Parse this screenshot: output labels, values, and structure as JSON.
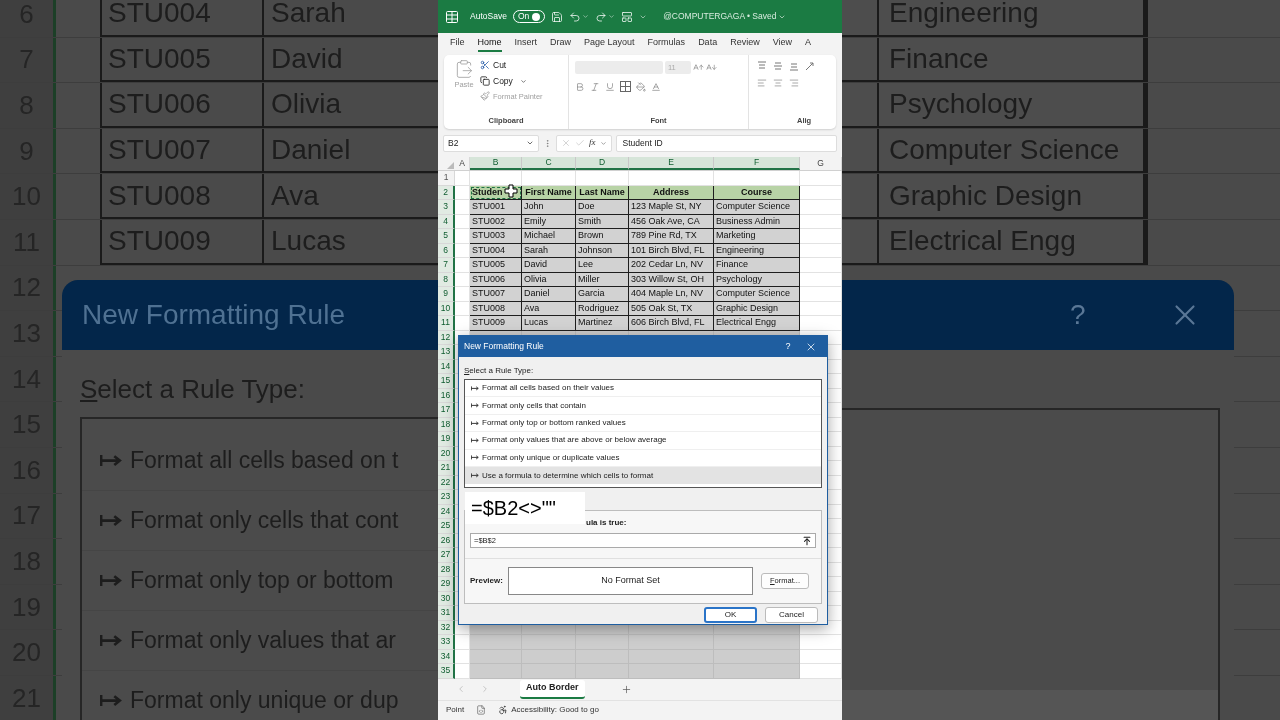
{
  "backdrop_left": {
    "row_numbers": [
      "6",
      "7",
      "8",
      "9",
      "10",
      "11",
      "12",
      "13",
      "14",
      "15",
      "16",
      "17",
      "18",
      "19",
      "20",
      "21"
    ],
    "rows": [
      [
        "STU004",
        "Sarah"
      ],
      [
        "STU005",
        "David"
      ],
      [
        "STU006",
        "Olivia"
      ],
      [
        "STU007",
        "Daniel"
      ],
      [
        "STU008",
        "Ava"
      ],
      [
        "STU009",
        "Lucas"
      ]
    ],
    "dialog": {
      "title": "New Formatting Rule",
      "label": "Select a Rule Type:",
      "rule_types": [
        "Format all cells based on t",
        "Format only cells that cont",
        "Format only top or bottom",
        "Format only values that ar",
        "Format only unique or dup"
      ]
    }
  },
  "excel": {
    "title_bar": {
      "autosave": "AutoSave",
      "toggle_label": "On",
      "autosave_on": true,
      "document": "@COMPUTERGAGA • Saved"
    },
    "tabs": [
      {
        "label": "File",
        "selected": false
      },
      {
        "label": "Home",
        "selected": true
      },
      {
        "label": "Insert",
        "selected": false
      },
      {
        "label": "Draw",
        "selected": false
      },
      {
        "label": "Page Layout",
        "selected": false
      },
      {
        "label": "Formulas",
        "selected": false
      },
      {
        "label": "Data",
        "selected": false
      },
      {
        "label": "Review",
        "selected": false
      },
      {
        "label": "View",
        "selected": false
      },
      {
        "label": "A",
        "selected": false
      }
    ],
    "ribbon": {
      "paste": {
        "label": "Paste",
        "disabled": true
      },
      "cut": {
        "label": "Cut",
        "disabled": false
      },
      "copy": {
        "label": "Copy",
        "disabled": false
      },
      "format_painter": {
        "label": "Format Painter",
        "disabled": true
      },
      "clipboard_label": "Clipboard",
      "font_size": "11",
      "font_label": "Font",
      "alignment_label": "Alig"
    },
    "formula_bar": {
      "name_box": "B2",
      "function_label": "fx",
      "value": "Student ID"
    },
    "sheet": {
      "columns": [
        {
          "label": "A",
          "selected": false
        },
        {
          "label": "B",
          "selected": true
        },
        {
          "label": "C",
          "selected": true
        },
        {
          "label": "D",
          "selected": true
        },
        {
          "label": "E",
          "selected": true
        },
        {
          "label": "F",
          "selected": true
        },
        {
          "label": "G",
          "selected": false
        }
      ],
      "rows": [
        {
          "n": "1",
          "selected": false
        },
        {
          "n": "2",
          "selected": true,
          "kind": "header",
          "cells": [
            "Studen",
            "First Name",
            "Last Name",
            "Address",
            "Course"
          ]
        },
        {
          "n": "3",
          "selected": true,
          "kind": "data",
          "cells": [
            "STU001",
            "John",
            "Doe",
            "123 Maple St, NY",
            "Computer Science"
          ]
        },
        {
          "n": "4",
          "selected": true,
          "kind": "data",
          "cells": [
            "STU002",
            "Emily",
            "Smith",
            "456 Oak Ave, CA",
            "Business Admin"
          ]
        },
        {
          "n": "5",
          "selected": true,
          "kind": "data",
          "cells": [
            "STU003",
            "Michael",
            "Brown",
            "789 Pine Rd, TX",
            "Marketing"
          ]
        },
        {
          "n": "6",
          "selected": true,
          "kind": "data",
          "cells": [
            "STU004",
            "Sarah",
            "Johnson",
            "101 Birch Blvd, FL",
            "Engineering"
          ]
        },
        {
          "n": "7",
          "selected": true,
          "kind": "data",
          "cells": [
            "STU005",
            "David",
            "Lee",
            "202 Cedar Ln, NV",
            "Finance"
          ]
        },
        {
          "n": "8",
          "selected": true,
          "kind": "data",
          "cells": [
            "STU006",
            "Olivia",
            "Miller",
            "303 Willow St, OH",
            "Psychology"
          ]
        },
        {
          "n": "9",
          "selected": true,
          "kind": "data",
          "cells": [
            "STU007",
            "Daniel",
            "Garcia",
            "404 Maple Ln, NV",
            "Computer Science"
          ]
        },
        {
          "n": "10",
          "selected": true,
          "kind": "data",
          "cells": [
            "STU008",
            "Ava",
            "Rodriguez",
            "505 Oak St, TX",
            "Graphic Design"
          ]
        },
        {
          "n": "11",
          "selected": true,
          "kind": "data",
          "cells": [
            "STU009",
            "Lucas",
            "Martinez",
            "606 Birch Blvd, FL",
            "Electrical Engg"
          ]
        },
        {
          "n": "12",
          "selected": true
        },
        {
          "n": "13",
          "selected": true
        },
        {
          "n": "14",
          "selected": true
        },
        {
          "n": "15",
          "selected": true
        },
        {
          "n": "16",
          "selected": true
        },
        {
          "n": "17",
          "selected": true
        },
        {
          "n": "18",
          "selected": true
        },
        {
          "n": "19",
          "selected": true
        },
        {
          "n": "20",
          "selected": true
        },
        {
          "n": "21",
          "selected": true
        },
        {
          "n": "22",
          "selected": true
        },
        {
          "n": "23",
          "selected": true
        },
        {
          "n": "24",
          "selected": true
        },
        {
          "n": "25",
          "selected": true
        },
        {
          "n": "26",
          "selected": true
        },
        {
          "n": "27",
          "selected": true
        },
        {
          "n": "28",
          "selected": true
        },
        {
          "n": "29",
          "selected": true
        },
        {
          "n": "30",
          "selected": true
        },
        {
          "n": "31",
          "selected": true
        },
        {
          "n": "32",
          "selected": true
        },
        {
          "n": "33",
          "selected": true
        },
        {
          "n": "34",
          "selected": true
        },
        {
          "n": "35",
          "selected": true
        }
      ]
    },
    "sheet_tabs": [
      {
        "label": "Auto Border",
        "selected": true
      }
    ],
    "status_bar": {
      "mode": "Point",
      "accessibility": "Accessibility: Good to go"
    },
    "dialog": {
      "title": "New Formatting Rule",
      "help": "?",
      "label": "Select a Rule Type:",
      "rule_types": [
        {
          "label": "Format all cells based on their values",
          "selected": false
        },
        {
          "label": "Format only cells that contain",
          "selected": false
        },
        {
          "label": "Format only top or bottom ranked values",
          "selected": false
        },
        {
          "label": "Format only values that are above or below average",
          "selected": false
        },
        {
          "label": "Format only unique or duplicate values",
          "selected": false
        },
        {
          "label": "Use a formula to determine which cells to format",
          "selected": true
        }
      ],
      "description_label": "ula is true:",
      "formula": "=$B$2",
      "preview_label": "Preview:",
      "preview": "No Format Set",
      "format_button": "Format...",
      "ok": "OK",
      "cancel": "Cancel"
    },
    "annotation": "=$B2<>\"\""
  },
  "backdrop_right": {
    "courses": [
      "Engineering",
      "Finance",
      "Psychology",
      "Computer Science",
      "Graphic Design",
      "Electrical Engg"
    ],
    "dialog": {
      "help": "?"
    }
  }
}
